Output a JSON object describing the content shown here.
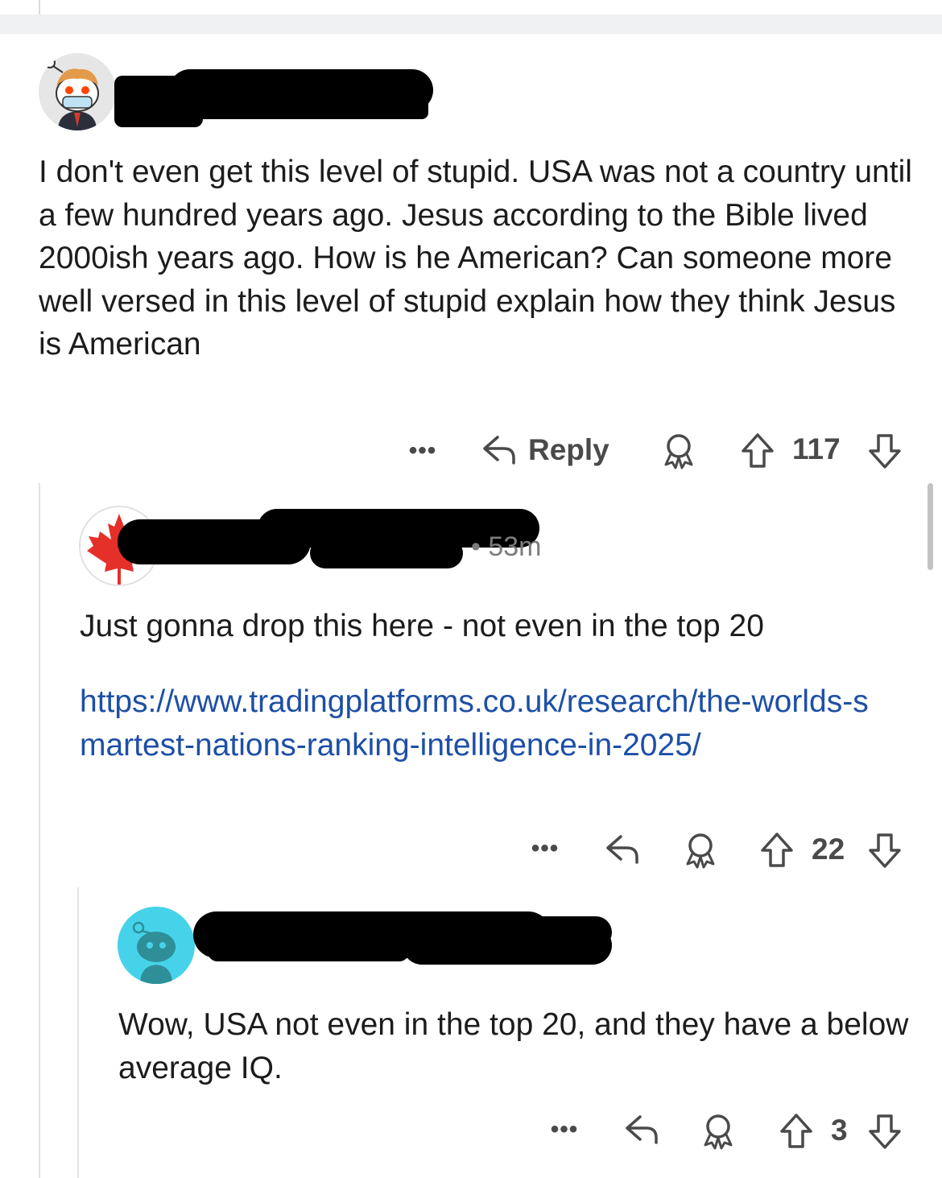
{
  "comments": [
    {
      "avatar_icon": "snoo-mask-avatar-icon",
      "username": "",
      "time": "",
      "body": "I don't even get this level of stupid. USA was not a country until a few hundred years ago. Jesus according to the Bible lived 2000ish years ago. How is he American? Can someone more well versed in this level of stupid explain how they think Jesus is American",
      "actions": {
        "more": "•••",
        "reply_label": "Reply",
        "score": "117"
      }
    },
    {
      "avatar_icon": "canada-flag-avatar-icon",
      "username": "",
      "time": "53m",
      "body": "Just gonna drop this here - not even in the top 20",
      "link": "https://www.tradingplatforms.co.uk/research/the-worlds-smartest-nations-ranking-intelligence-in-2025/",
      "actions": {
        "more": "•••",
        "score": "22"
      }
    },
    {
      "avatar_icon": "snoo-default-avatar-icon",
      "username": "",
      "time": "",
      "body": "Wow, USA not even in the top 20, and they have a below average IQ.",
      "actions": {
        "more": "•••",
        "score": "3"
      }
    }
  ],
  "colors": {
    "link": "#1d4fa6",
    "action_gray": "#4a4a4a",
    "separator": "#eef0f2",
    "thread_line": "#e3e3e3"
  }
}
